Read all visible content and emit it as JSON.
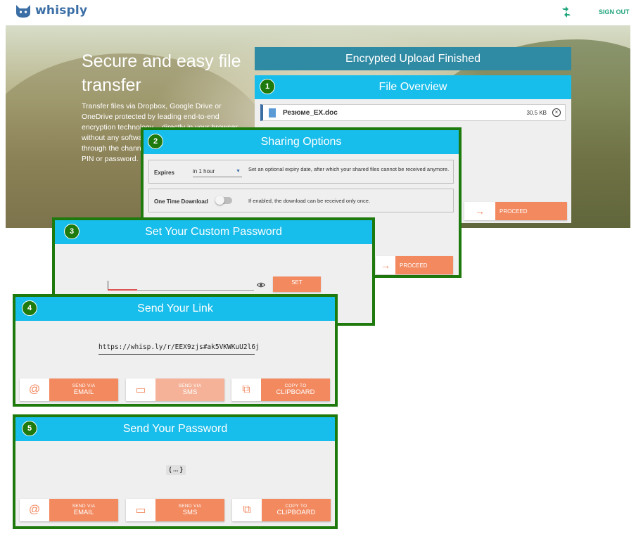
{
  "app": {
    "logo_text": "whisply",
    "signout_label": "SIGN OUT"
  },
  "colors": {
    "accent": "#f2895f",
    "header_blue": "#17bdeb",
    "dark_header": "#2f8aa3",
    "frame_green": "#1f7a0d",
    "brand": "#3a6ea5"
  },
  "hero": {
    "title": "Secure and easy file transfer",
    "description": "Transfer files via Dropbox, Google Drive or OneDrive protected by leading end-to-end encryption technology – directly in your browser without any software installation. Secure your files through the channel of your choice with an optional PIN or password."
  },
  "upload": {
    "header": "Encrypted Upload Finished"
  },
  "file_overview": {
    "step": "1",
    "title": "File Overview",
    "file": {
      "name": "Резюме_EX.doc",
      "size": "30.5 KB"
    },
    "proceed_label": "PROCEED"
  },
  "sharing": {
    "step": "2",
    "title": "Sharing Options",
    "expires": {
      "label": "Expires",
      "value": "in 1 hour",
      "description": "Set an optional expiry date, after which your shared files cannot be received anymore."
    },
    "one_time": {
      "label": "One Time Download",
      "description": "If enabled, the download can be received only once.",
      "enabled": false
    },
    "proceed_label": "PROCEED"
  },
  "password": {
    "step": "3",
    "title": "Set Your Custom Password",
    "input_value": "",
    "set_label": "SET"
  },
  "send_link": {
    "step": "4",
    "title": "Send Your Link",
    "link": "https://whisp.ly/r/EEX9zjs#ak5VKWKuU2l6j",
    "buttons": [
      {
        "top": "SEND VIA",
        "bottom": "EMAIL",
        "icon": "at-icon"
      },
      {
        "top": "SEND VIA",
        "bottom": "SMS",
        "icon": "message-icon"
      },
      {
        "top": "COPY TO",
        "bottom": "CLIPBOARD",
        "icon": "copy-icon"
      }
    ]
  },
  "send_password": {
    "step": "5",
    "title": "Send Your Password",
    "value": "( ... }",
    "buttons": [
      {
        "top": "SEND VIA",
        "bottom": "EMAIL",
        "icon": "at-icon"
      },
      {
        "top": "SEND VIA",
        "bottom": "SMS",
        "icon": "message-icon"
      },
      {
        "top": "COPY TO",
        "bottom": "CLIPBOARD",
        "icon": "copy-icon"
      }
    ]
  }
}
